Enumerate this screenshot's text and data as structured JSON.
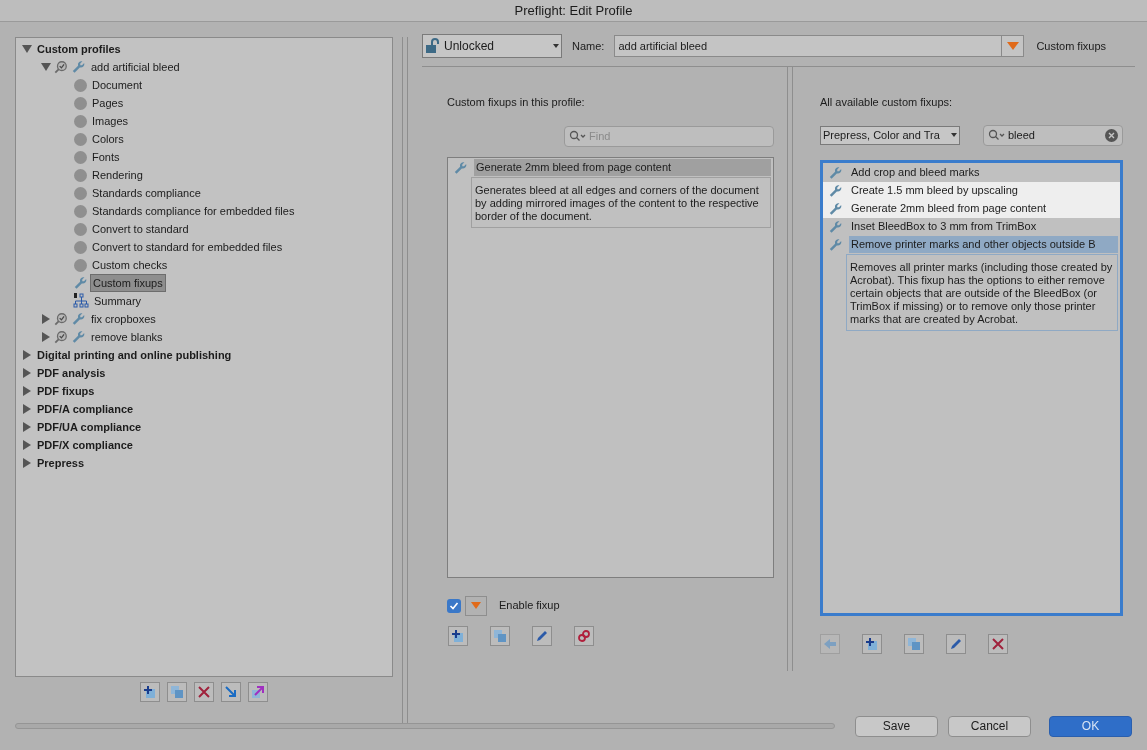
{
  "window": {
    "title": "Preflight: Edit Profile"
  },
  "tree": [
    {
      "label": "Custom profiles",
      "kind": "category",
      "expanded": true,
      "selected": false,
      "children": [
        {
          "label": "add artificial bleed",
          "kind": "profile",
          "expanded": true,
          "selected": false,
          "children": [
            {
              "label": "Document",
              "kind": "section",
              "selected": false
            },
            {
              "label": "Pages",
              "kind": "section",
              "selected": false
            },
            {
              "label": "Images",
              "kind": "section",
              "selected": false
            },
            {
              "label": "Colors",
              "kind": "section",
              "selected": false
            },
            {
              "label": "Fonts",
              "kind": "section",
              "selected": false
            },
            {
              "label": "Rendering",
              "kind": "section",
              "selected": false
            },
            {
              "label": "Standards compliance",
              "kind": "section",
              "selected": false
            },
            {
              "label": "Standards compliance for embedded files",
              "kind": "section",
              "selected": false
            },
            {
              "label": "Convert to standard",
              "kind": "section",
              "selected": false
            },
            {
              "label": "Convert to standard for embedded files",
              "kind": "section",
              "selected": false
            },
            {
              "label": "Custom checks",
              "kind": "section",
              "selected": false
            },
            {
              "label": "Custom fixups",
              "kind": "fixups",
              "selected": true
            },
            {
              "label": "Summary",
              "kind": "summary",
              "selected": false
            }
          ]
        },
        {
          "label": "fix cropboxes",
          "kind": "profile",
          "expanded": false,
          "selected": false
        },
        {
          "label": "remove blanks",
          "kind": "profile",
          "expanded": false,
          "selected": false
        }
      ]
    },
    {
      "label": "Digital printing and online publishing",
      "kind": "category",
      "expanded": false,
      "selected": false
    },
    {
      "label": "PDF analysis",
      "kind": "category",
      "expanded": false,
      "selected": false
    },
    {
      "label": "PDF fixups",
      "kind": "category",
      "expanded": false,
      "selected": false
    },
    {
      "label": "PDF/A compliance",
      "kind": "category",
      "expanded": false,
      "selected": false
    },
    {
      "label": "PDF/UA compliance",
      "kind": "category",
      "expanded": false,
      "selected": false
    },
    {
      "label": "PDF/X compliance",
      "kind": "category",
      "expanded": false,
      "selected": false
    },
    {
      "label": "Prepress",
      "kind": "category",
      "expanded": false,
      "selected": false
    }
  ],
  "lock": {
    "value": "Unlocked"
  },
  "name_field": {
    "label": "Name:",
    "value": "add artificial bleed"
  },
  "section_title": "Custom fixups",
  "profile_fixups": {
    "heading": "Custom fixups in this profile:",
    "search": {
      "placeholder": "Find"
    },
    "items": [
      {
        "label": "Generate 2mm bleed from page content",
        "selected": true,
        "highlighted": false,
        "description": "Generates bleed at all edges and corners of the document by adding mirrored images of the content to the respective border of the document."
      }
    ],
    "enable": {
      "label": "Enable fixup",
      "checked": true
    }
  },
  "available_fixups": {
    "heading": "All available custom fixups:",
    "filter": "Prepress, Color and Tra",
    "search": {
      "value": "bleed"
    },
    "items": [
      {
        "label": "Add crop and bleed marks",
        "selected": false,
        "highlighted": false
      },
      {
        "label": "Create 1.5 mm bleed by upscaling",
        "selected": false,
        "highlighted": true
      },
      {
        "label": "Generate 2mm bleed from page content",
        "selected": false,
        "highlighted": true
      },
      {
        "label": "Inset BleedBox to 3 mm from TrimBox",
        "selected": false,
        "highlighted": false
      },
      {
        "label": "Remove printer marks and other objects outside B",
        "selected": true,
        "highlighted": false,
        "description": "Removes all printer marks (including those created by Acrobat). This fixup has the options to either remove certain objects that are outside of the BleedBox (or TrimBox if missing) or to remove only those printer marks that are created by Acrobat."
      }
    ]
  },
  "progress": {
    "level": 0
  },
  "buttons": [
    {
      "label": "Save",
      "kind": "normal"
    },
    {
      "label": "Cancel",
      "kind": "normal"
    },
    {
      "label": "OK",
      "kind": "default"
    }
  ]
}
